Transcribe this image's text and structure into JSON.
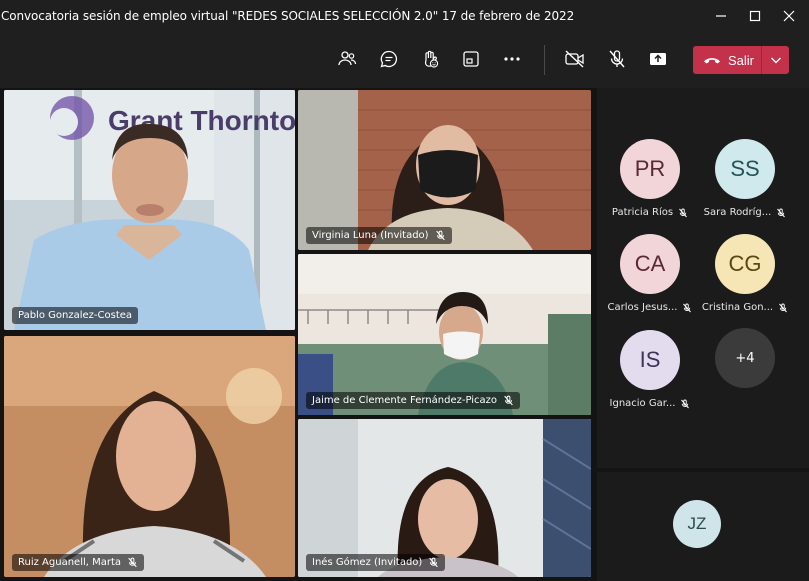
{
  "window": {
    "title": "Convocatoria sesión de empleo virtual \"REDES SOCIALES SELECCIÓN 2.0\" 17 de febrero de 2022"
  },
  "toolbar": {
    "leave_label": "Salir"
  },
  "colors": {
    "leave_button": "#c4314b",
    "active_speaker_outline": "#8b8cc7",
    "background": "#1f1f1f"
  },
  "tiles": [
    {
      "name": "Pablo Gonzalez-Costea",
      "muted": false,
      "logo_text": "Grant Thornton"
    },
    {
      "name": "Virginia Luna (Invitado)",
      "muted": true
    },
    {
      "name": "Jaime de Clemente Fernández-Picazo",
      "muted": true
    },
    {
      "name": "Ruiz Aguanell, Marta",
      "muted": true
    },
    {
      "name": "Inés Gómez (Invitado)",
      "muted": true
    }
  ],
  "roster": [
    {
      "initials": "PR",
      "name": "Patricia Ríos",
      "color": "#f2d5d8"
    },
    {
      "initials": "SS",
      "name": "Sara Rodríg...",
      "color": "#cfe9ec"
    },
    {
      "initials": "CA",
      "name": "Carlos Jesus...",
      "color": "#f2d5d8"
    },
    {
      "initials": "CG",
      "name": "Cristina Gon...",
      "color": "#f6e6b6"
    },
    {
      "initials": "IS",
      "name": "Ignacio Gar...",
      "color": "#e3dcef"
    }
  ],
  "more_count": "+4",
  "self": {
    "initials": "JZ"
  }
}
